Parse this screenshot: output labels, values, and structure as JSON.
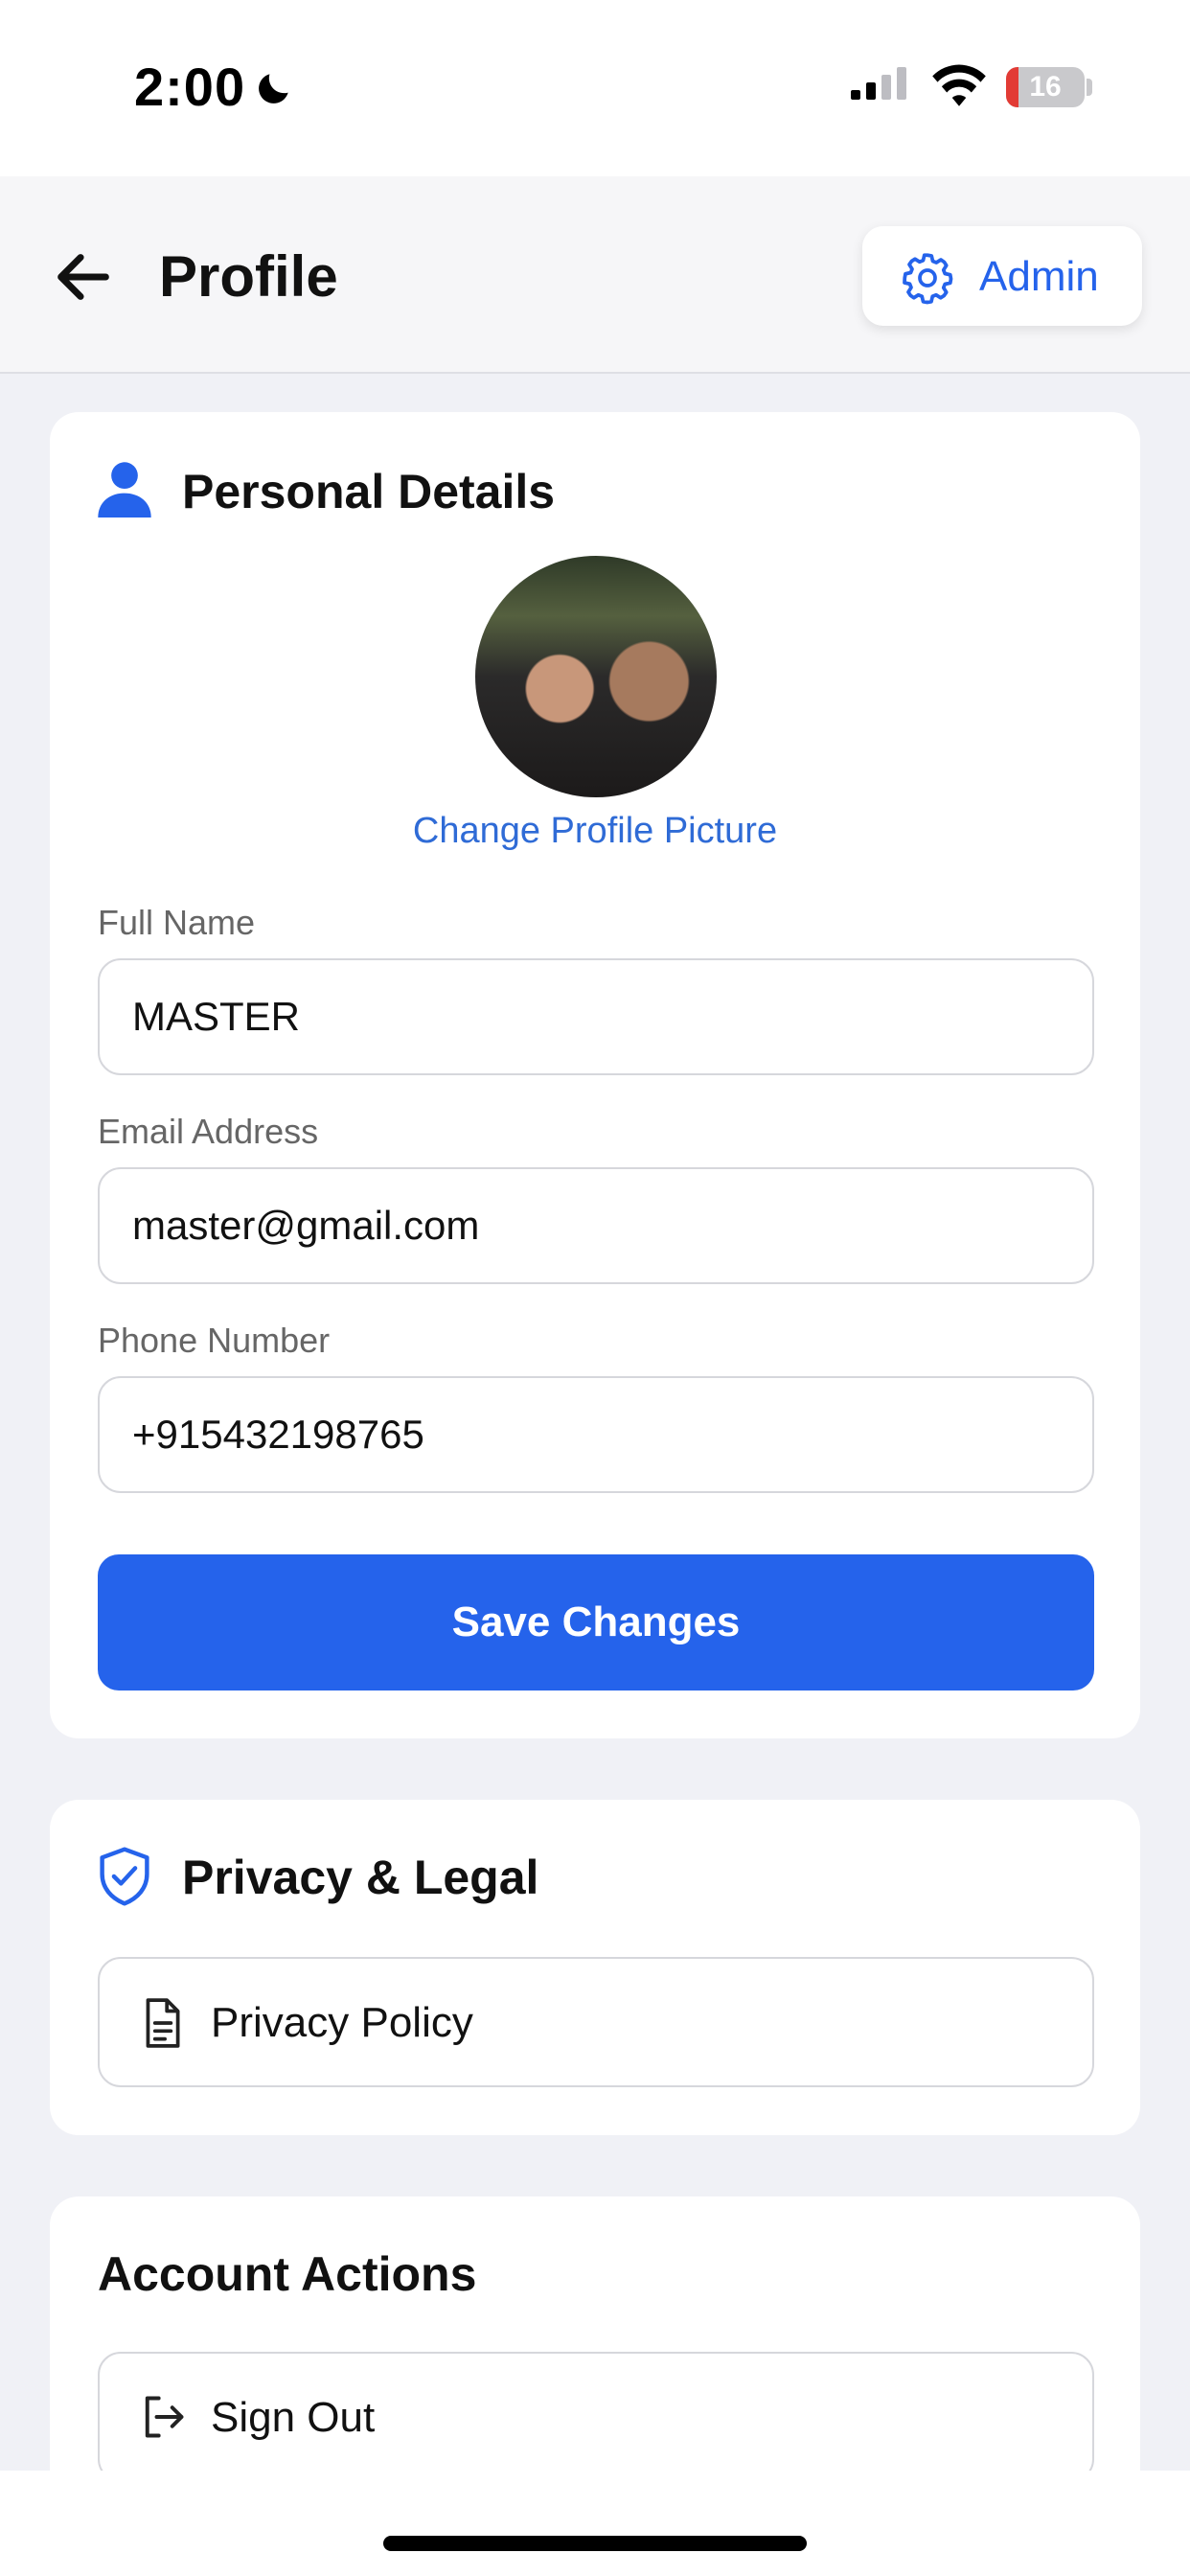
{
  "status_bar": {
    "time": "2:00",
    "battery_level": "16",
    "icons": [
      "moon-icon",
      "cellular-signal-icon",
      "wifi-icon",
      "battery-icon"
    ]
  },
  "header": {
    "title": "Profile",
    "admin_label": "Admin",
    "icons": [
      "back-arrow-icon",
      "gear-icon"
    ]
  },
  "personal_details": {
    "title": "Personal Details",
    "change_picture": "Change Profile Picture",
    "fields": [
      {
        "label": "Full Name",
        "value": "MASTER"
      },
      {
        "label": "Email Address",
        "value": "master@gmail.com"
      },
      {
        "label": "Phone Number",
        "value": "+915432198765"
      }
    ],
    "save_label": "Save Changes",
    "icons": [
      "person-icon"
    ]
  },
  "privacy": {
    "title": "Privacy & Legal",
    "policy_label": "Privacy Policy",
    "icons": [
      "shield-check-icon",
      "document-icon"
    ]
  },
  "account": {
    "title": "Account Actions",
    "sign_out_label": "Sign Out",
    "icons": [
      "sign-out-icon"
    ]
  },
  "colors": {
    "accent": "#2563eb",
    "link": "#2f6bd6",
    "background": "#f0f1f6",
    "card": "#ffffff",
    "battery_low": "#e23b35"
  }
}
